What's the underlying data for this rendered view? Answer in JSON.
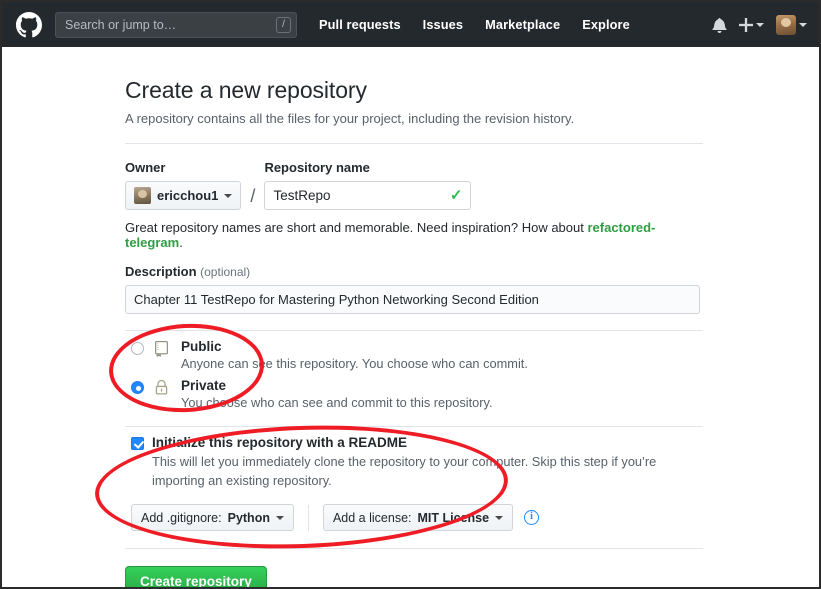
{
  "topnav": {
    "logo_name": "github-logo",
    "search": {
      "placeholder": "Search or jump to…",
      "shortcut": "/"
    },
    "links": [
      {
        "label": "Pull requests"
      },
      {
        "label": "Issues"
      },
      {
        "label": "Marketplace"
      },
      {
        "label": "Explore"
      }
    ],
    "icons": {
      "notifications": "bell-icon",
      "create_new": "plus-icon",
      "account": "avatar"
    }
  },
  "page": {
    "title": "Create a new repository",
    "subtitle": "A repository contains all the files for your project, including the revision history."
  },
  "form": {
    "owner_label": "Owner",
    "owner_value": "ericchou1",
    "separator": "/",
    "repo_label": "Repository name",
    "repo_value": "TestRepo",
    "repo_valid_icon": "check-icon",
    "helper_prefix": "Great repository names are short and memorable. Need inspiration? How about ",
    "helper_suggestion": "refactored-telegram",
    "helper_suffix": ".",
    "description_label": "Description",
    "description_optional": "(optional)",
    "description_value": "Chapter 11 TestRepo for Mastering Python Networking Second Edition"
  },
  "visibility": {
    "options": [
      {
        "title": "Public",
        "desc": "Anyone can see this repository. You choose who can commit.",
        "icon": "repo-book-icon",
        "selected": false
      },
      {
        "title": "Private",
        "desc": "You choose who can see and commit to this repository.",
        "icon": "lock-icon",
        "selected": true
      }
    ]
  },
  "initialize": {
    "checkbox_label": "Initialize this repository with a README",
    "checkbox_checked": true,
    "description": "This will let you immediately clone the repository to your computer. Skip this step if you’re importing an existing repository.",
    "gitignore_label": "Add .gitignore:",
    "gitignore_value": "Python",
    "license_label": "Add a license:",
    "license_value": "MIT License",
    "info_icon": "info-icon"
  },
  "submit": {
    "label": "Create repository"
  },
  "annotations": {
    "color": "#ee1c25",
    "shapes": [
      {
        "name": "visibility-highlight",
        "type": "ellipse"
      },
      {
        "name": "initialize-highlight",
        "type": "ellipse"
      }
    ]
  }
}
